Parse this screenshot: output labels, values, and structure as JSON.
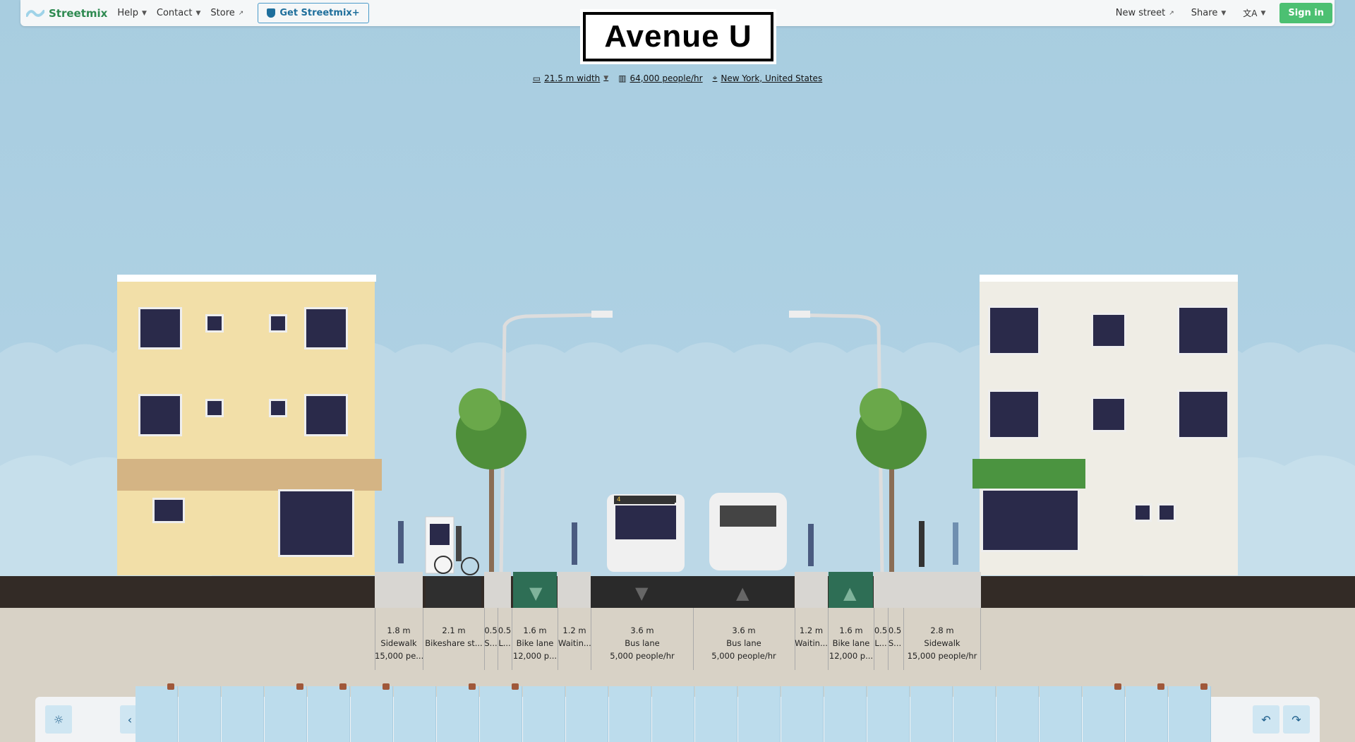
{
  "menubar": {
    "logo_text": "Streetmix",
    "help": "Help",
    "contact": "Contact",
    "store": "Store",
    "get_plus": "Get Streetmix+",
    "new_street": "New street",
    "share": "Share",
    "language_icon": "translate-icon",
    "sign_in": "Sign in"
  },
  "street": {
    "name": "Avenue U",
    "width": "21.5 m width",
    "capacity": "64,000 people/hr",
    "location": "New York, United States"
  },
  "segments": [
    {
      "width": "1.8 m",
      "name": "Sidewalk",
      "capacity": "15,000 pe..."
    },
    {
      "width": "2.1 m",
      "name": "Bikeshare st...",
      "capacity": ""
    },
    {
      "width": "0.5",
      "name": "S...",
      "capacity": ""
    },
    {
      "width": "0.5",
      "name": "L...",
      "capacity": ""
    },
    {
      "width": "1.6 m",
      "name": "Bike lane",
      "capacity": "12,000 p..."
    },
    {
      "width": "1.2 m",
      "name": "Waitin...",
      "capacity": ""
    },
    {
      "width": "3.6 m",
      "name": "Bus lane",
      "capacity": "5,000 people/hr"
    },
    {
      "width": "3.6 m",
      "name": "Bus lane",
      "capacity": "5,000 people/hr"
    },
    {
      "width": "1.2 m",
      "name": "Waitin...",
      "capacity": ""
    },
    {
      "width": "1.6 m",
      "name": "Bike lane",
      "capacity": "12,000 p..."
    },
    {
      "width": "0.5",
      "name": "L...",
      "capacity": ""
    },
    {
      "width": "0.5",
      "name": "S...",
      "capacity": ""
    },
    {
      "width": "2.8 m",
      "name": "Sidewalk",
      "capacity": "15,000 people/hr"
    }
  ],
  "bus_route": "4",
  "palette": {
    "theme_icon": "sun-icon",
    "scroll_left_icon": "chevron-left-icon",
    "undo_icon": "undo-icon",
    "redo_icon": "redo-icon"
  },
  "colors": {
    "brand": "#2e8a51",
    "sign_in": "#4cc072",
    "bike_lane": "#2e6e55",
    "road": "#332b26",
    "sidewalk": "#d8d6d2"
  }
}
